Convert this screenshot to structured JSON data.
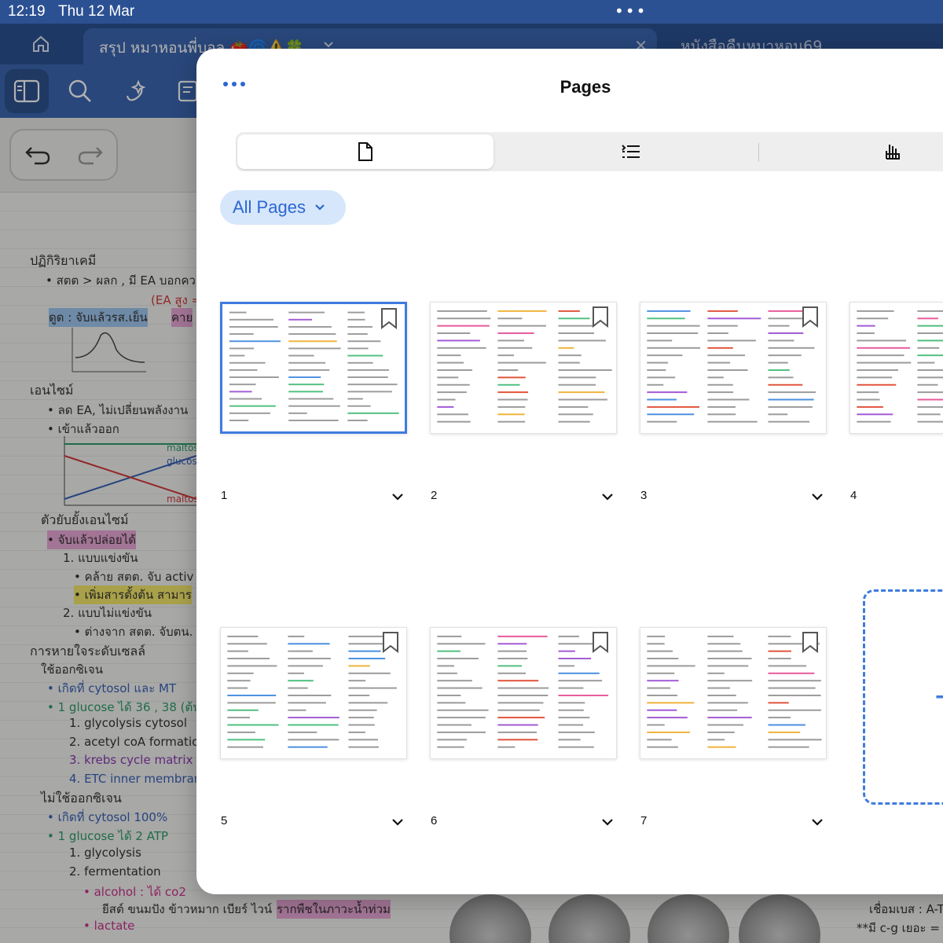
{
  "status": {
    "time": "12:19",
    "date": "Thu 12 Mar",
    "dots": "•••"
  },
  "tabs": {
    "active_title": "สรุป หมาหอนพี่บอล 🍅🌀⚠️🍀",
    "other_title": "หนังสือคืนหมาหอน69",
    "close": "✕"
  },
  "toolbar": {
    "icons": [
      "sidebar-icon",
      "search-icon",
      "sparkle-lasso-icon",
      "text-icon"
    ]
  },
  "note_lines": [
    "ปฏิกิริยาเคมี",
    "•  สตต > ผลก , มี EA บอกคว",
    "(EA สูง =",
    "ดูด : จับแล้วรส.เย็น",
    "คาย",
    "เอนไซม์",
    "•  ลด EA, ไม่เปลี่ยนพลังงาน",
    "•  เข้าแล้วออก",
    "maltose",
    "glucose",
    "maltose",
    "ตัวยับยั้งเอนไซม์",
    "•  จับแล้วปล่อยได้",
    "1. แบบแข่งขัน",
    "•  คล้าย สตต. จับ activ",
    "•  เพิ่มสารตั้งต้น สามาร",
    "2. แบบไม่แข่งขัน",
    "•  ต่างจาก สตต. จับตน.",
    "การหายใจระดับเซลล์",
    "ใช้ออกซิเจน",
    "•  เกิดที่  cytosol และ MT",
    "•  1 glucose ได้ 36 , 38 (ต้น",
    "1. glycolysis  cytosol",
    "2. acetyl coA formation",
    "3. krebs cycle matrix",
    "4. ETC inner membrane",
    "ไม่ใช้ออกซิเจน",
    "•  เกิดที่  cytosol 100%",
    "•  1 glucose ได้ 2 ATP",
    "1. glycolysis",
    "2. fermentation",
    "•  alcohol : ได้ co2",
    "ยีสต์ ขนมปัง ข้าวหมาก เบียร์ ไวน์",
    "รากพืชในภาวะน้ำท่วม",
    "•  lactate",
    "เชื่อมเบส : A-T",
    "**มี c-g เยอะ ="
  ],
  "sheet": {
    "title": "Pages",
    "segments": [
      "page-icon",
      "outline-icon",
      "bookmark-gesture-icon"
    ],
    "filter_label": "All Pages",
    "add_label": "+"
  },
  "pages": [
    {
      "number": "1",
      "selected": true
    },
    {
      "number": "2",
      "selected": false
    },
    {
      "number": "3",
      "selected": false
    },
    {
      "number": "4",
      "selected": false
    },
    {
      "number": "5",
      "selected": false
    },
    {
      "number": "6",
      "selected": false
    },
    {
      "number": "7",
      "selected": false
    }
  ],
  "colors": {
    "accent": "#3f7be0",
    "header_blue": "#2b5193",
    "toolbar_blue": "#3c66b0",
    "filter_bg": "#d6e6fb"
  }
}
